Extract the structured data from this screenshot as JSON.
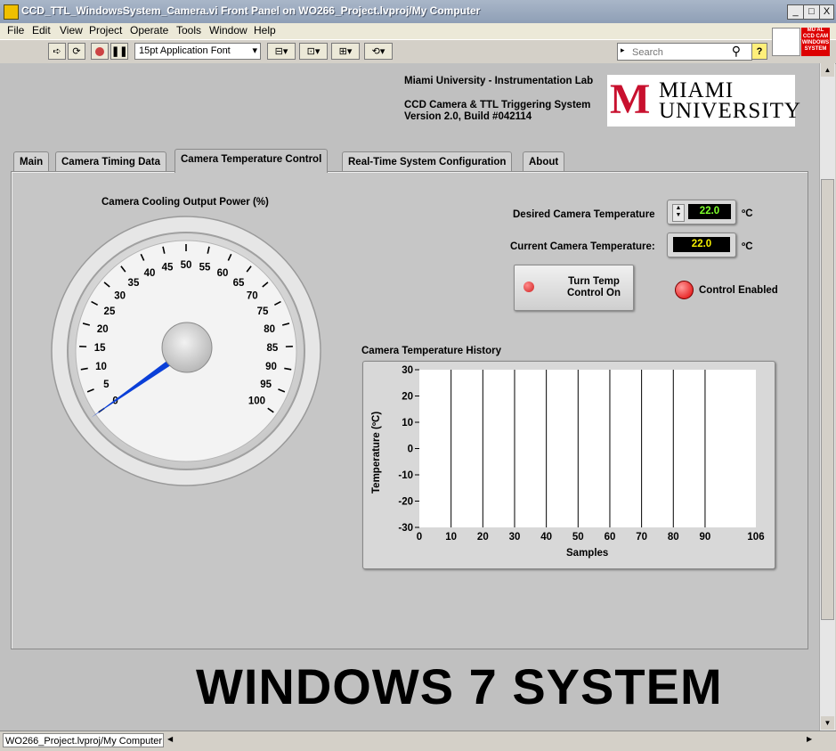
{
  "window": {
    "title": "CCD_TTL_WindowsSystem_Camera.vi Front Panel on WO266_Project.lvproj/My Computer",
    "controls": [
      "_",
      "□",
      "X"
    ]
  },
  "menu": [
    "File",
    "Edit",
    "View",
    "Project",
    "Operate",
    "Tools",
    "Window",
    "Help"
  ],
  "toolbar": {
    "font_select": "15pt Application Font",
    "search_placeholder": "Search",
    "help_label": "?",
    "corner_icon_text": "MU AL CCD CAM WINDOWS SYSTEM"
  },
  "header": {
    "lab": "Miami University - Instrumentation Lab",
    "system": "CCD Camera & TTL Triggering System",
    "version": "Version 2.0, Build #042114",
    "logo_line1": "MIAMI",
    "logo_line2": "UNIVERSITY",
    "logo_letter": "M"
  },
  "tabs": [
    "Main",
    "Camera Timing Data",
    "Camera Temperature Control",
    "Real-Time System Configuration",
    "About"
  ],
  "active_tab": "Camera Temperature Control",
  "gauge": {
    "label": "Camera Cooling Output Power (%)",
    "min": 0,
    "max": 100,
    "labels": [
      "0",
      "5",
      "10",
      "15",
      "20",
      "25",
      "30",
      "35",
      "40",
      "45",
      "50",
      "55",
      "60",
      "65",
      "70",
      "75",
      "80",
      "85",
      "90",
      "95",
      "100"
    ],
    "value": 0
  },
  "temperature": {
    "desired_label": "Desired Camera Temperature",
    "desired_value": "22.0",
    "current_label": "Current Camera Temperature:",
    "current_value": "22.0",
    "unit": "ºC"
  },
  "control": {
    "button_line1": "Turn Temp",
    "button_line2": "Control On",
    "indicator_label": "Control Enabled",
    "indicator_color": "#e00000"
  },
  "chart_data": {
    "type": "line",
    "title": "Camera Temperature History",
    "xlabel": "Samples",
    "ylabel": "Temperature (ºC)",
    "xlim": [
      0,
      106
    ],
    "ylim": [
      -30,
      30
    ],
    "xticks": [
      "0",
      "10",
      "20",
      "30",
      "40",
      "50",
      "60",
      "70",
      "80",
      "90",
      "106"
    ],
    "yticks": [
      "30",
      "20",
      "10",
      "0",
      "-10",
      "-20",
      "-30"
    ],
    "series": []
  },
  "banner": "WINDOWS 7 SYSTEM",
  "status": "WO266_Project.lvproj/My Computer"
}
